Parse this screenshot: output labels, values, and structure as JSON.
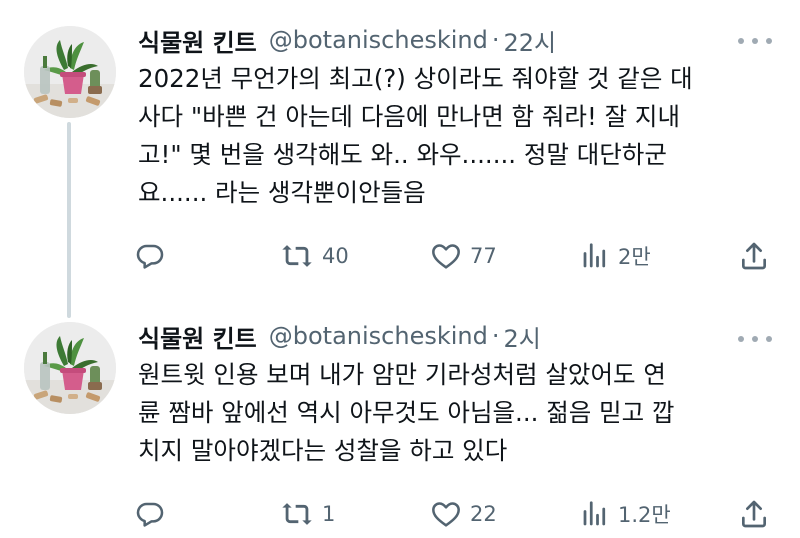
{
  "tweets": [
    {
      "author": {
        "name": "식물원 킨트",
        "handle": "@botanischeskind",
        "avatar_icon": "plant-photo-avatar"
      },
      "separator": "·",
      "time": "22시",
      "text_lines": [
        "2022년 무언가의 최고(?) 상이라도 줘야할 것 같은 대",
        "사다 \"바쁜 건 아는데 다음에 만나면 함 줘라! 잘 지내",
        "고!\" 몇 번을 생각해도 와.. 와우....... 정말 대단하군",
        "요...... 라는 생각뿐이안들음"
      ],
      "actions": {
        "reply": "",
        "retweet": "40",
        "like": "77",
        "views": "2만"
      }
    },
    {
      "author": {
        "name": "식물원 킨트",
        "handle": "@botanischeskind",
        "avatar_icon": "plant-photo-avatar"
      },
      "separator": "·",
      "time": "2시",
      "text_lines": [
        "원트윗 인용 보며 내가 암만 기라성처럼 살았어도 연",
        "륜 짬바 앞에선 역시 아무것도 아님을... 젊음 믿고 깝",
        "치지 말아야겠다는 성찰을 하고 있다"
      ],
      "actions": {
        "reply": "",
        "retweet": "1",
        "like": "22",
        "views": "1.2만"
      }
    }
  ],
  "colors": {
    "text_primary": "#0f1419",
    "text_secondary": "#536471",
    "thread_line": "#cfd9de"
  }
}
